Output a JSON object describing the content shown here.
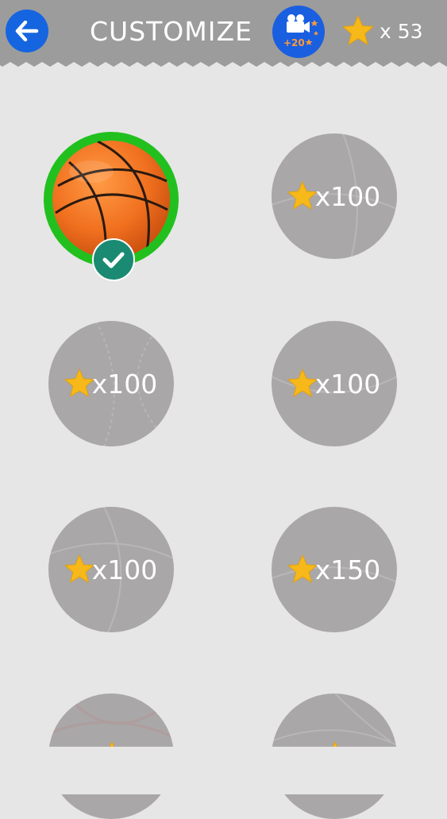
{
  "header": {
    "title": "CUSTOMIZE",
    "video_reward": "+20",
    "star_count": "x 53",
    "background_color": "#9c9c9c",
    "back_button_color": "#1565e0"
  },
  "balls": [
    {
      "state": "selected",
      "price": ""
    },
    {
      "state": "locked",
      "price": "x100"
    },
    {
      "state": "locked",
      "price": "x100"
    },
    {
      "state": "locked",
      "price": "x100"
    },
    {
      "state": "locked",
      "price": "x100"
    },
    {
      "state": "locked",
      "price": "x150"
    },
    {
      "state": "locked",
      "price": ""
    },
    {
      "state": "locked",
      "price": ""
    }
  ],
  "icons": {
    "back": "arrow-left-icon",
    "video": "video-camera-icon",
    "star": "star-icon",
    "check": "checkmark-icon"
  },
  "colors": {
    "selected_ring": "#22c01f",
    "locked_ball": "#a9a7a7",
    "check_badge": "#1a8a73",
    "star": "#f7b81a"
  }
}
